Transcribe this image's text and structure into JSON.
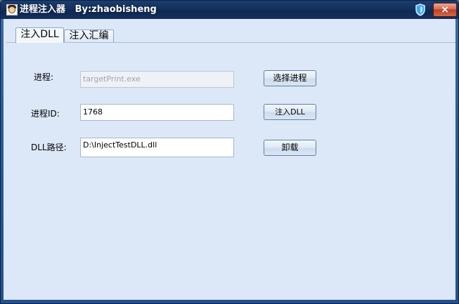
{
  "window": {
    "title": "进程注入器   By:zhaobisheng",
    "close_label": "×"
  },
  "tabs": [
    {
      "label": "注入DLL",
      "selected": true
    },
    {
      "label": "注入汇编",
      "selected": false
    }
  ],
  "form": {
    "process_label": "进程:",
    "process_value": "targetPrint.exe",
    "process_id_label": "进程ID:",
    "process_id_value": "1768",
    "dll_path_label": "DLL路径:",
    "dll_path_value": "D:\\InjectTestDLL.dll"
  },
  "buttons": {
    "select_process": "选择进程",
    "inject_dll": "注入DLL",
    "unload": "卸载"
  },
  "icons": {
    "app": "app-portrait-icon",
    "shield": "shield-icon",
    "close": "close-icon"
  },
  "colors": {
    "title_bar": "#14305d",
    "client_background": "#dce8f8",
    "close_button": "#c13d22"
  }
}
